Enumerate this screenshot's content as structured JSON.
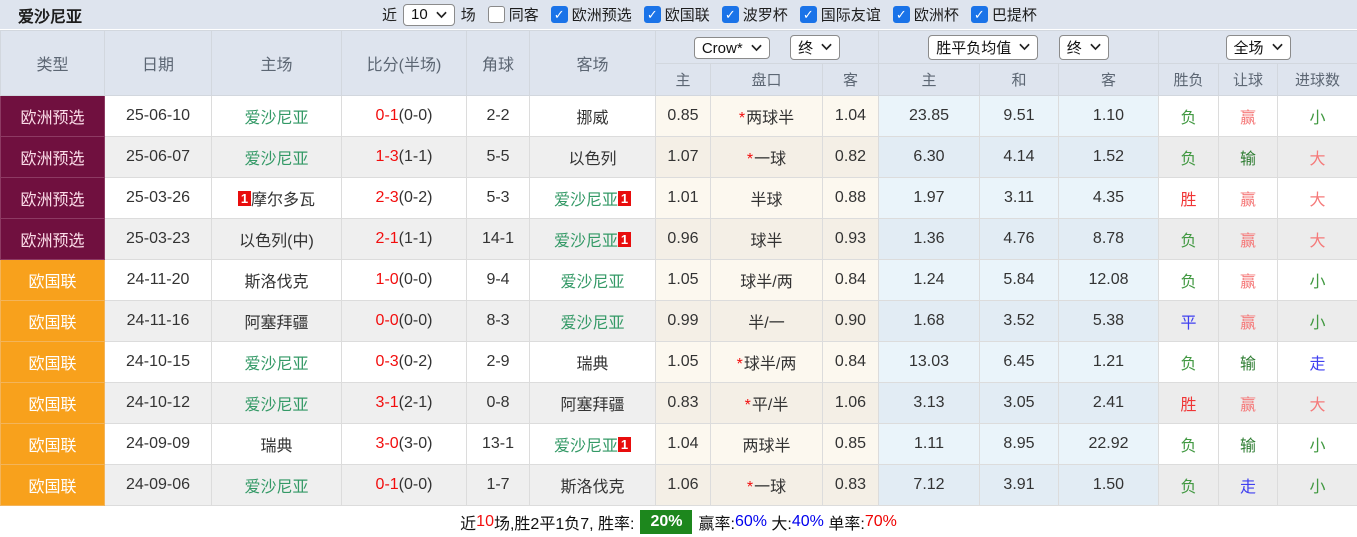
{
  "topbar": {
    "title": "爱沙尼亚",
    "recent_label": "近",
    "recent_value": "10",
    "matches_label": "场",
    "same_venue": {
      "label": "同客",
      "checked": false
    },
    "leagues": [
      {
        "label": "欧洲预选",
        "checked": true
      },
      {
        "label": "欧国联",
        "checked": true
      },
      {
        "label": "波罗杯",
        "checked": true
      },
      {
        "label": "国际友谊",
        "checked": true
      },
      {
        "label": "欧洲杯",
        "checked": true
      },
      {
        "label": "巴提杯",
        "checked": true
      }
    ]
  },
  "table": {
    "main_headers": [
      "类型",
      "日期",
      "主场",
      "比分(半场)",
      "角球",
      "客场"
    ],
    "selectors": {
      "odds_company": "Crow*",
      "odds_time": "终",
      "avg_type": "胜平负均值",
      "avg_time": "终",
      "scope": "全场"
    },
    "sub_headers": [
      "主",
      "盘口",
      "客",
      "主",
      "和",
      "客",
      "胜负",
      "让球",
      "进球数"
    ],
    "colors": {
      "type_maroon": "#70103f",
      "type_orange": "#f8a11c",
      "team_green": "#339966",
      "score_red": "#f20d0d",
      "win_red": "#f03535",
      "lose_green": "#429942",
      "draw_blue": "#4040f0",
      "handicap_win_lightred": "#f57a7a",
      "handicap_lose_darkgreen": "#2e7d32",
      "rate_box_green": "#1d871d"
    },
    "rows": [
      {
        "type": "欧洲预选",
        "type_style": "maroon",
        "date": "25-06-10",
        "home": {
          "name": "爱沙尼亚",
          "green": true,
          "badge_before": "",
          "badge_after": ""
        },
        "score": "0-1",
        "half_score": "(0-0)",
        "corners": "2-2",
        "away": {
          "name": "挪威",
          "green": false,
          "badge_after": ""
        },
        "odds": {
          "home": "0.85",
          "star": true,
          "handicap": "两球半",
          "away": "1.04"
        },
        "avg": {
          "win": "23.85",
          "draw": "9.51",
          "lose": "1.10"
        },
        "outcome": {
          "text": "负",
          "color": "green"
        },
        "handicap_result": {
          "text": "赢",
          "color": "lightred"
        },
        "goals_result": {
          "text": "小",
          "color": "green"
        }
      },
      {
        "type": "欧洲预选",
        "type_style": "maroon",
        "date": "25-06-07",
        "home": {
          "name": "爱沙尼亚",
          "green": true,
          "badge_before": "",
          "badge_after": ""
        },
        "score": "1-3",
        "half_score": "(1-1)",
        "corners": "5-5",
        "away": {
          "name": "以色列",
          "green": false,
          "badge_after": ""
        },
        "odds": {
          "home": "1.07",
          "star": true,
          "handicap": "一球",
          "away": "0.82"
        },
        "avg": {
          "win": "6.30",
          "draw": "4.14",
          "lose": "1.52"
        },
        "outcome": {
          "text": "负",
          "color": "green"
        },
        "handicap_result": {
          "text": "输",
          "color": "darkgreen"
        },
        "goals_result": {
          "text": "大",
          "color": "lightred"
        }
      },
      {
        "type": "欧洲预选",
        "type_style": "maroon",
        "date": "25-03-26",
        "home": {
          "name": "摩尔多瓦",
          "green": false,
          "badge_before": "1",
          "badge_after": ""
        },
        "score": "2-3",
        "half_score": "(0-2)",
        "corners": "5-3",
        "away": {
          "name": "爱沙尼亚",
          "green": true,
          "badge_after": "1"
        },
        "odds": {
          "home": "1.01",
          "star": false,
          "handicap": "半球",
          "away": "0.88"
        },
        "avg": {
          "win": "1.97",
          "draw": "3.11",
          "lose": "4.35"
        },
        "outcome": {
          "text": "胜",
          "color": "red"
        },
        "handicap_result": {
          "text": "赢",
          "color": "lightred"
        },
        "goals_result": {
          "text": "大",
          "color": "lightred"
        }
      },
      {
        "type": "欧洲预选",
        "type_style": "maroon",
        "date": "25-03-23",
        "home": {
          "name": "以色列(中)",
          "green": false,
          "badge_before": "",
          "badge_after": ""
        },
        "score": "2-1",
        "half_score": "(1-1)",
        "corners": "14-1",
        "away": {
          "name": "爱沙尼亚",
          "green": true,
          "badge_after": "1"
        },
        "odds": {
          "home": "0.96",
          "star": false,
          "handicap": "球半",
          "away": "0.93"
        },
        "avg": {
          "win": "1.36",
          "draw": "4.76",
          "lose": "8.78"
        },
        "outcome": {
          "text": "负",
          "color": "green"
        },
        "handicap_result": {
          "text": "赢",
          "color": "lightred"
        },
        "goals_result": {
          "text": "大",
          "color": "lightred"
        }
      },
      {
        "type": "欧国联",
        "type_style": "orange",
        "date": "24-11-20",
        "home": {
          "name": "斯洛伐克",
          "green": false,
          "badge_before": "",
          "badge_after": ""
        },
        "score": "1-0",
        "half_score": "(0-0)",
        "corners": "9-4",
        "away": {
          "name": "爱沙尼亚",
          "green": true,
          "badge_after": ""
        },
        "odds": {
          "home": "1.05",
          "star": false,
          "handicap": "球半/两",
          "away": "0.84"
        },
        "avg": {
          "win": "1.24",
          "draw": "5.84",
          "lose": "12.08"
        },
        "outcome": {
          "text": "负",
          "color": "green"
        },
        "handicap_result": {
          "text": "赢",
          "color": "lightred"
        },
        "goals_result": {
          "text": "小",
          "color": "green"
        }
      },
      {
        "type": "欧国联",
        "type_style": "orange",
        "date": "24-11-16",
        "home": {
          "name": "阿塞拜疆",
          "green": false,
          "badge_before": "",
          "badge_after": ""
        },
        "score": "0-0",
        "half_score": "(0-0)",
        "corners": "8-3",
        "away": {
          "name": "爱沙尼亚",
          "green": true,
          "badge_after": ""
        },
        "odds": {
          "home": "0.99",
          "star": false,
          "handicap": "半/一",
          "away": "0.90"
        },
        "avg": {
          "win": "1.68",
          "draw": "3.52",
          "lose": "5.38"
        },
        "outcome": {
          "text": "平",
          "color": "blue"
        },
        "handicap_result": {
          "text": "赢",
          "color": "lightred"
        },
        "goals_result": {
          "text": "小",
          "color": "green"
        }
      },
      {
        "type": "欧国联",
        "type_style": "orange",
        "date": "24-10-15",
        "home": {
          "name": "爱沙尼亚",
          "green": true,
          "badge_before": "",
          "badge_after": ""
        },
        "score": "0-3",
        "half_score": "(0-2)",
        "corners": "2-9",
        "away": {
          "name": "瑞典",
          "green": false,
          "badge_after": ""
        },
        "odds": {
          "home": "1.05",
          "star": true,
          "handicap": "球半/两",
          "away": "0.84"
        },
        "avg": {
          "win": "13.03",
          "draw": "6.45",
          "lose": "1.21"
        },
        "outcome": {
          "text": "负",
          "color": "green"
        },
        "handicap_result": {
          "text": "输",
          "color": "darkgreen"
        },
        "goals_result": {
          "text": "走",
          "color": "blue"
        }
      },
      {
        "type": "欧国联",
        "type_style": "orange",
        "date": "24-10-12",
        "home": {
          "name": "爱沙尼亚",
          "green": true,
          "badge_before": "",
          "badge_after": ""
        },
        "score": "3-1",
        "half_score": "(2-1)",
        "corners": "0-8",
        "away": {
          "name": "阿塞拜疆",
          "green": false,
          "badge_after": ""
        },
        "odds": {
          "home": "0.83",
          "star": true,
          "handicap": "平/半",
          "away": "1.06"
        },
        "avg": {
          "win": "3.13",
          "draw": "3.05",
          "lose": "2.41"
        },
        "outcome": {
          "text": "胜",
          "color": "red"
        },
        "handicap_result": {
          "text": "赢",
          "color": "lightred"
        },
        "goals_result": {
          "text": "大",
          "color": "lightred"
        }
      },
      {
        "type": "欧国联",
        "type_style": "orange",
        "date": "24-09-09",
        "home": {
          "name": "瑞典",
          "green": false,
          "badge_before": "",
          "badge_after": ""
        },
        "score": "3-0",
        "half_score": "(3-0)",
        "corners": "13-1",
        "away": {
          "name": "爱沙尼亚",
          "green": true,
          "badge_after": "1"
        },
        "odds": {
          "home": "1.04",
          "star": false,
          "handicap": "两球半",
          "away": "0.85"
        },
        "avg": {
          "win": "1.11",
          "draw": "8.95",
          "lose": "22.92"
        },
        "outcome": {
          "text": "负",
          "color": "green"
        },
        "handicap_result": {
          "text": "输",
          "color": "darkgreen"
        },
        "goals_result": {
          "text": "小",
          "color": "green"
        }
      },
      {
        "type": "欧国联",
        "type_style": "orange",
        "date": "24-09-06",
        "home": {
          "name": "爱沙尼亚",
          "green": true,
          "badge_before": "",
          "badge_after": ""
        },
        "score": "0-1",
        "half_score": "(0-0)",
        "corners": "1-7",
        "away": {
          "name": "斯洛伐克",
          "green": false,
          "badge_after": ""
        },
        "odds": {
          "home": "1.06",
          "star": true,
          "handicap": "一球",
          "away": "0.83"
        },
        "avg": {
          "win": "7.12",
          "draw": "3.91",
          "lose": "1.50"
        },
        "outcome": {
          "text": "负",
          "color": "green"
        },
        "handicap_result": {
          "text": "走",
          "color": "blue"
        },
        "goals_result": {
          "text": "小",
          "color": "green"
        }
      }
    ]
  },
  "footer": {
    "t1": "近",
    "count": "10",
    "t2": "场,胜2平1负7, 胜率:",
    "win_rate": "20%",
    "t3": "赢率:",
    "win_pct": "60%",
    "t4": " 大:",
    "big_pct": "40%",
    "t5": " 单率:",
    "single_pct": "70%"
  }
}
